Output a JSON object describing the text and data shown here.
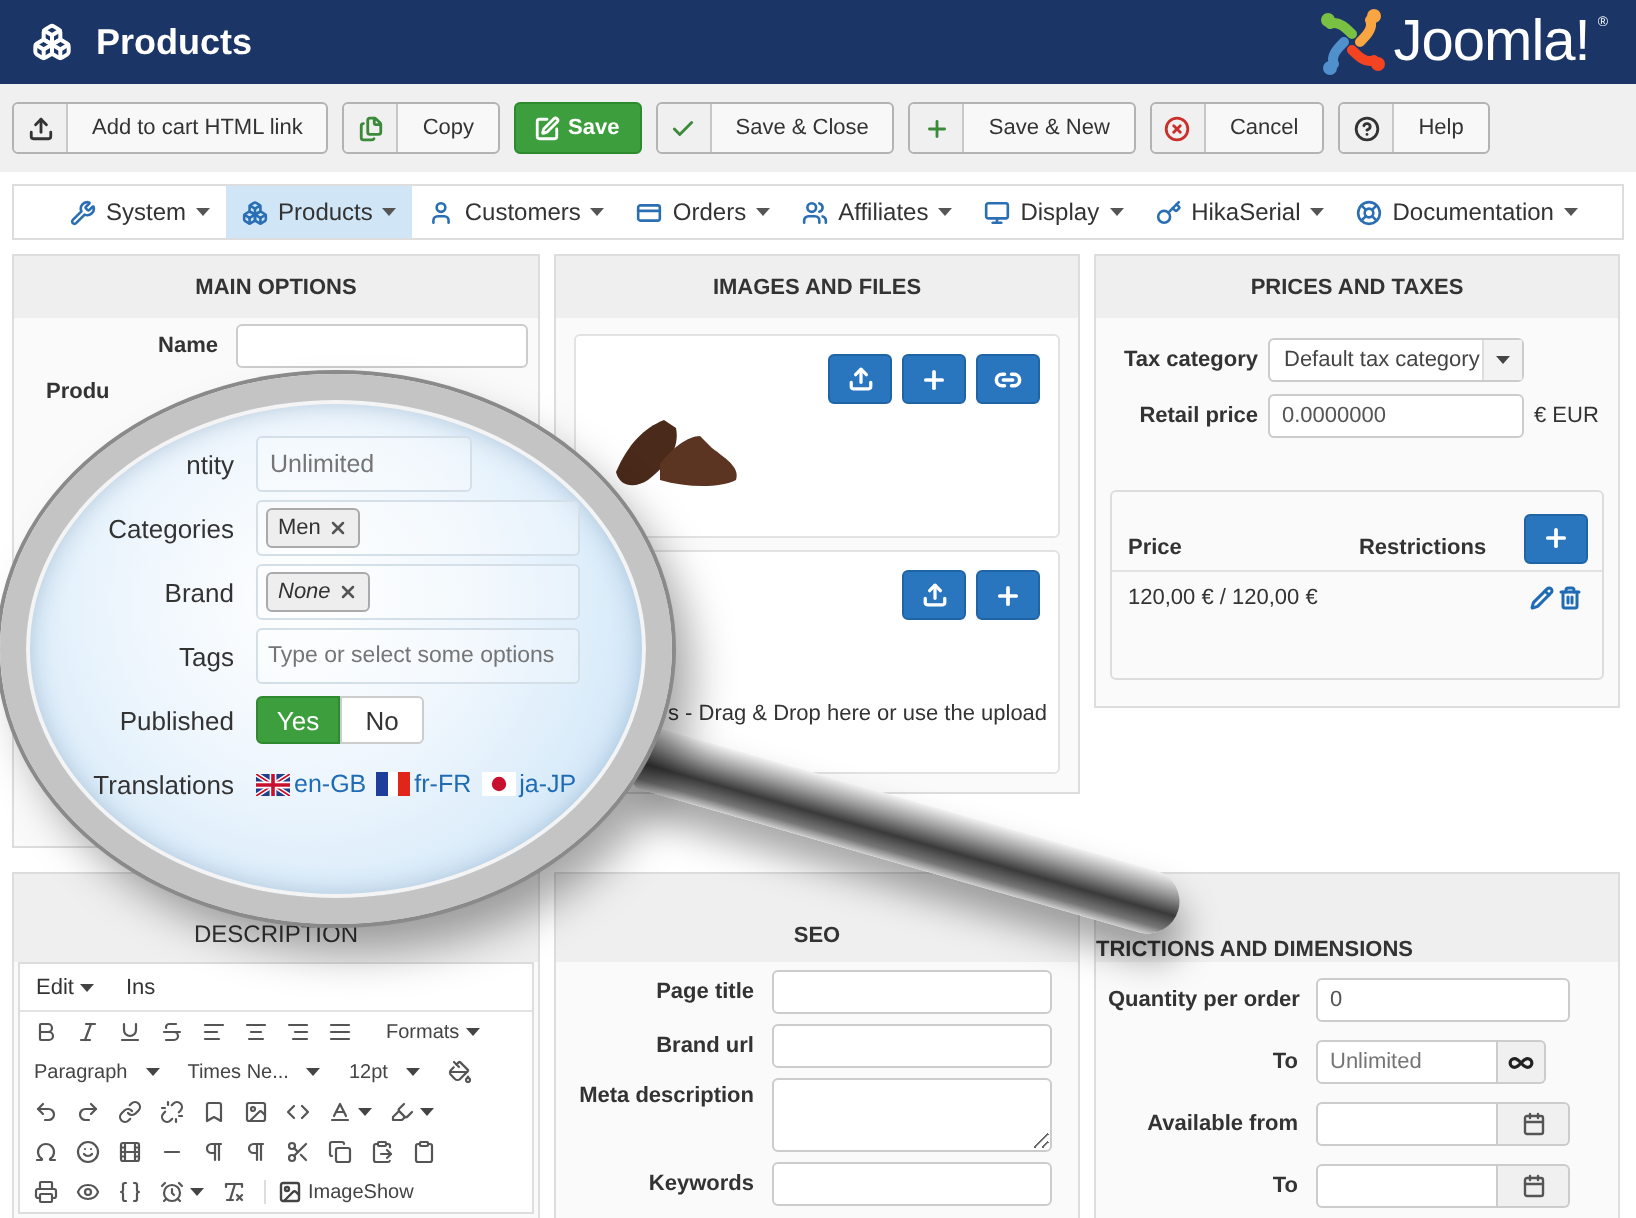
{
  "header": {
    "title": "Products",
    "logo": {
      "text": "Joomla!",
      "mark": "®"
    }
  },
  "toolbar": [
    {
      "label": "Add to cart HTML link",
      "kind": "default"
    },
    {
      "label": "Copy",
      "kind": "default"
    },
    {
      "label": "Save",
      "kind": "primary"
    },
    {
      "label": "Save & Close",
      "kind": "default"
    },
    {
      "label": "Save & New",
      "kind": "default"
    },
    {
      "label": "Cancel",
      "kind": "default"
    },
    {
      "label": "Help",
      "kind": "default"
    }
  ],
  "menu": [
    {
      "label": "System",
      "selected": false
    },
    {
      "label": "Products",
      "selected": true
    },
    {
      "label": "Customers",
      "selected": false
    },
    {
      "label": "Orders",
      "selected": false
    },
    {
      "label": "Affiliates",
      "selected": false
    },
    {
      "label": "Display",
      "selected": false
    },
    {
      "label": "HikaSerial",
      "selected": false
    },
    {
      "label": "Documentation",
      "selected": false
    }
  ],
  "main_options": {
    "title": "MAIN OPTIONS",
    "fields": [
      {
        "label": "Name"
      },
      {
        "label": "Produ"
      }
    ]
  },
  "magnifier": {
    "quantity": {
      "label": "ntity",
      "placeholder": "Unlimited"
    },
    "categories": {
      "label": "Categories",
      "tags": [
        "Men"
      ]
    },
    "brand": {
      "label": "Brand",
      "tags": [
        "None"
      ]
    },
    "tags": {
      "label": "Tags",
      "placeholder": "Type or select some options"
    },
    "published": {
      "label": "Published",
      "options": [
        {
          "label": "Yes",
          "selected": true
        },
        {
          "label": "No",
          "selected": false
        }
      ]
    },
    "translations": {
      "label": "Translations",
      "languages": [
        "en-GB",
        "fr-FR",
        "ja-JP"
      ]
    }
  },
  "images_and_files": {
    "title": "IMAGES AND FILES",
    "files_hint": "s - Drag & Drop here or use the upload"
  },
  "prices_and_taxes": {
    "title": "PRICES AND TAXES",
    "tax_category": {
      "label": "Tax category",
      "value": "Default tax category"
    },
    "retail_price": {
      "label": "Retail price",
      "value": "0.0000000",
      "currency": "€ EUR"
    },
    "price_table": {
      "columns": [
        "Price",
        "Restrictions"
      ],
      "rows": [
        {
          "price": "120,00 € / 120,00 €"
        }
      ]
    }
  },
  "description": {
    "title": "DESCRIPTION",
    "editor": {
      "menus": [
        "Edit",
        "Ins"
      ],
      "formats": "Formats",
      "selects": [
        "Paragraph",
        "Times Ne...",
        "12pt"
      ],
      "plugin_button": "ImageShow"
    }
  },
  "seo": {
    "title": "SEO",
    "fields": [
      {
        "label": "Page title",
        "kind": "input"
      },
      {
        "label": "Brand url",
        "kind": "input"
      },
      {
        "label": "Meta description",
        "kind": "textarea"
      },
      {
        "label": "Keywords",
        "kind": "input"
      }
    ]
  },
  "restrictions": {
    "title": "TRICTIONS AND DIMENSIONS",
    "fields": [
      {
        "label": "Quantity per order",
        "kind": "input",
        "value": "0"
      },
      {
        "label": "To",
        "kind": "infinite",
        "placeholder": "Unlimited"
      },
      {
        "label": "Available from",
        "kind": "date"
      },
      {
        "label": "To",
        "kind": "date"
      }
    ]
  }
}
